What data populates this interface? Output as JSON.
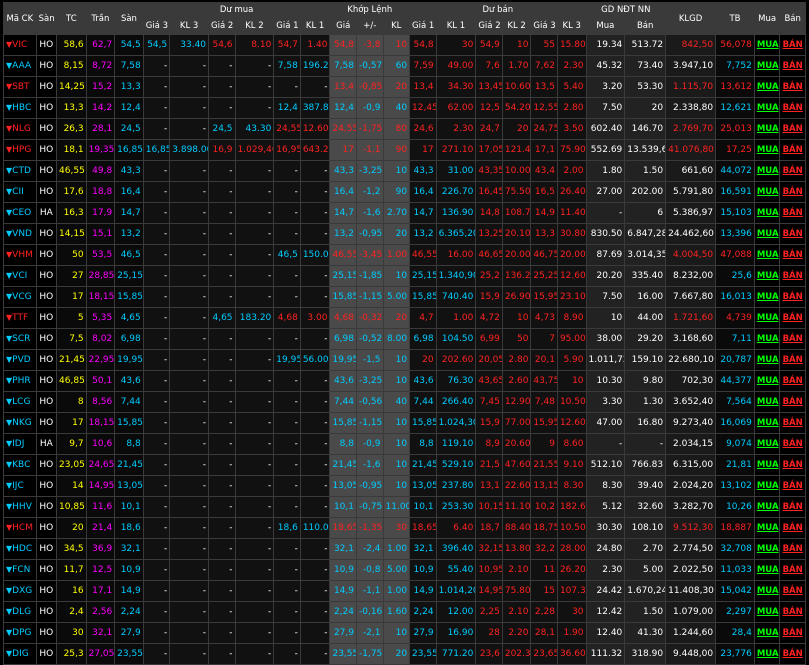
{
  "header": {
    "groups": {
      "symbol": "Mã CK",
      "exchange": "Sàn",
      "tc": "TC",
      "tran": "Trần",
      "san": "Sàn",
      "buy": "Dư mua",
      "match": "Khớp Lệnh",
      "sell": "Dư bán",
      "nn": "GD NĐT NN",
      "klgd": "KLGD",
      "tb": "TB",
      "mua": "Mua",
      "ban": "Bán"
    },
    "sub": {
      "buy": [
        "Giá 3",
        "KL 3",
        "Giá 2",
        "KL 2",
        "Giá 1",
        "KL 1"
      ],
      "match": [
        "Giá",
        "+/-",
        "KL"
      ],
      "sell": [
        "Giá 1",
        "KL 1",
        "Giá 2",
        "KL 2",
        "Giá 3",
        "KL 3"
      ],
      "nn": [
        "Mua",
        "Bán"
      ]
    }
  },
  "rows": [
    {
      "sym": "VIC",
      "dir": "dn",
      "ex": "HO",
      "tc": "58,6",
      "tran": "62,7",
      "san": "54,5",
      "b3p": "54,5",
      "b3k": "33.40",
      "b2p": "54,6",
      "b2k": "8.10",
      "b1p": "54,7",
      "b1k": "1.40",
      "mp": "54,8",
      "mc": "-3,8",
      "mk": "10",
      "s1p": "54,8",
      "s1k": "30",
      "s2p": "54,9",
      "s2k": "10",
      "s3p": "55",
      "s3k": "15.80",
      "nnb": "19.34",
      "nns": "513.72",
      "klgd": "842,50",
      "tb": "56,078"
    },
    {
      "sym": "AAA",
      "dir": "dn",
      "ex": "HO",
      "tc": "8,15",
      "tran": "8,72",
      "san": "7,58",
      "b3p": "-",
      "b3k": "-",
      "b2p": "-",
      "b2k": "-",
      "b1p": "7,58",
      "b1k": "196.20",
      "mp": "7,58",
      "mc": "-0,57",
      "mk": "60",
      "s1p": "7,59",
      "s1k": "49.00",
      "s2p": "7,6",
      "s2k": "1.70",
      "s3p": "7,62",
      "s3k": "2.30",
      "nnb": "45.32",
      "nns": "73.40",
      "klgd": "3.947,10",
      "tb": "7,752"
    },
    {
      "sym": "SBT",
      "dir": "dn",
      "ex": "HO",
      "tc": "14,25",
      "tran": "15,2",
      "san": "13,3",
      "b3p": "-",
      "b3k": "-",
      "b2p": "-",
      "b2k": "-",
      "b1p": "-",
      "b1k": "-",
      "mp": "13,4",
      "mc": "-0,85",
      "mk": "20",
      "s1p": "13,4",
      "s1k": "34.30",
      "s2p": "13,45",
      "s2k": "10.60",
      "s3p": "13,5",
      "s3k": "5.40",
      "nnb": "3.20",
      "nns": "53.30",
      "klgd": "1.115,70",
      "tb": "13,612"
    },
    {
      "sym": "HBC",
      "dir": "dn",
      "ex": "HO",
      "tc": "13,3",
      "tran": "14,2",
      "san": "12,4",
      "b3p": "-",
      "b3k": "-",
      "b2p": "-",
      "b2k": "-",
      "b1p": "12,4",
      "b1k": "387.80",
      "mp": "12,4",
      "mc": "-0,9",
      "mk": "40",
      "s1p": "12,45",
      "s1k": "62.00",
      "s2p": "12,5",
      "s2k": "54.20",
      "s3p": "12,55",
      "s3k": "2.80",
      "nnb": "7.50",
      "nns": "20",
      "klgd": "2.338,80",
      "tb": "12,621"
    },
    {
      "sym": "NLG",
      "dir": "dn",
      "ex": "HO",
      "tc": "26,3",
      "tran": "28,1",
      "san": "24,5",
      "b3p": "-",
      "b3k": "-",
      "b2p": "24,5",
      "b2k": "43.30",
      "b1p": "24,55",
      "b1k": "12.60",
      "mp": "24,55",
      "mc": "-1,75",
      "mk": "80",
      "s1p": "24,6",
      "s1k": "2.30",
      "s2p": "24,7",
      "s2k": "20",
      "s3p": "24,75",
      "s3k": "3.50",
      "nnb": "602.40",
      "nns": "146.70",
      "klgd": "2.769,70",
      "tb": "25,013"
    },
    {
      "sym": "HPG",
      "dir": "dn",
      "ex": "HO",
      "tc": "18,1",
      "tran": "19,35",
      "san": "16,85",
      "b3p": "16,85",
      "b3k": "3.898.00",
      "b2p": "16,9",
      "b2k": "1.029,40",
      "b1p": "16,95",
      "b1k": "643.20",
      "mp": "17",
      "mc": "-1,1",
      "mk": "90",
      "s1p": "17",
      "s1k": "271.10",
      "s2p": "17,05",
      "s2k": "121.40",
      "s3p": "17,1",
      "s3k": "75.90",
      "nnb": "552.69",
      "nns": "13.539,60",
      "klgd": "41.076,80",
      "tb": "17,25"
    },
    {
      "sym": "CTD",
      "dir": "dn",
      "ex": "HO",
      "tc": "46,55",
      "tran": "49,8",
      "san": "43,3",
      "b3p": "-",
      "b3k": "-",
      "b2p": "-",
      "b2k": "-",
      "b1p": "-",
      "b1k": "-",
      "mp": "43,3",
      "mc": "-3,25",
      "mk": "10",
      "s1p": "43,3",
      "s1k": "31.00",
      "s2p": "43,35",
      "s2k": "10.00",
      "s3p": "43,4",
      "s3k": "2.00",
      "nnb": "1.80",
      "nns": "1.50",
      "klgd": "661,60",
      "tb": "44,072"
    },
    {
      "sym": "CII",
      "dir": "dn",
      "ex": "HO",
      "tc": "17,6",
      "tran": "18,8",
      "san": "16,4",
      "b3p": "-",
      "b3k": "-",
      "b2p": "-",
      "b2k": "-",
      "b1p": "-",
      "b1k": "-",
      "mp": "16,4",
      "mc": "-1,2",
      "mk": "90",
      "s1p": "16,4",
      "s1k": "226.70",
      "s2p": "16,45",
      "s2k": "75.50",
      "s3p": "16,5",
      "s3k": "26.40",
      "nnb": "27.00",
      "nns": "202.00",
      "klgd": "5.791,80",
      "tb": "16,591"
    },
    {
      "sym": "CEO",
      "dir": "dn",
      "ex": "HA",
      "tc": "16,3",
      "tran": "17,9",
      "san": "14,7",
      "b3p": "-",
      "b3k": "-",
      "b2p": "-",
      "b2k": "-",
      "b1p": "-",
      "b1k": "-",
      "mp": "14,7",
      "mc": "-1,6",
      "mk": "2.70",
      "s1p": "14,7",
      "s1k": "136.90",
      "s2p": "14,8",
      "s2k": "108.70",
      "s3p": "14,9",
      "s3k": "11.40",
      "nnb": "-",
      "nns": "6",
      "klgd": "5.386,97",
      "tb": "15,103"
    },
    {
      "sym": "VND",
      "dir": "dn",
      "ex": "HO",
      "tc": "14,15",
      "tran": "15,1",
      "san": "13,2",
      "b3p": "-",
      "b3k": "-",
      "b2p": "-",
      "b2k": "-",
      "b1p": "-",
      "b1k": "-",
      "mp": "13,2",
      "mc": "-0,95",
      "mk": "20",
      "s1p": "13,2",
      "s1k": "6.365,20",
      "s2p": "13,25",
      "s2k": "20.10",
      "s3p": "13,3",
      "s3k": "30.80",
      "nnb": "830.50",
      "nns": "6.847,28",
      "klgd": "24.462,60",
      "tb": "13,396"
    },
    {
      "sym": "VHM",
      "dir": "dn",
      "ex": "HO",
      "tc": "50",
      "tran": "53,5",
      "san": "46,5",
      "b3p": "-",
      "b3k": "-",
      "b2p": "-",
      "b2k": "-",
      "b1p": "46,5",
      "b1k": "150.00",
      "mp": "46,55",
      "mc": "-3,45",
      "mk": "1.00",
      "s1p": "46,55",
      "s1k": "16.00",
      "s2p": "46,65",
      "s2k": "20.00",
      "s3p": "46,75",
      "s3k": "20.00",
      "nnb": "87.69",
      "nns": "3.014,35",
      "klgd": "4.004,50",
      "tb": "47,088"
    },
    {
      "sym": "VCI",
      "dir": "dn",
      "ex": "HO",
      "tc": "27",
      "tran": "28,85",
      "san": "25,15",
      "b3p": "-",
      "b3k": "-",
      "b2p": "-",
      "b2k": "-",
      "b1p": "-",
      "b1k": "-",
      "mp": "25,15",
      "mc": "-1,85",
      "mk": "10",
      "s1p": "25,15",
      "s1k": "1.340,90",
      "s2p": "25,2",
      "s2k": "136.20",
      "s3p": "25,25",
      "s3k": "12.60",
      "nnb": "20.20",
      "nns": "335.40",
      "klgd": "8.232,00",
      "tb": "25,6"
    },
    {
      "sym": "VCG",
      "dir": "dn",
      "ex": "HO",
      "tc": "17",
      "tran": "18,15",
      "san": "15,85",
      "b3p": "-",
      "b3k": "-",
      "b2p": "-",
      "b2k": "-",
      "b1p": "-",
      "b1k": "-",
      "mp": "15,85",
      "mc": "-1,15",
      "mk": "5.00",
      "s1p": "15,85",
      "s1k": "740.40",
      "s2p": "15,9",
      "s2k": "26.90",
      "s3p": "15,95",
      "s3k": "23.10",
      "nnb": "7.50",
      "nns": "16.00",
      "klgd": "7.667,80",
      "tb": "16,013"
    },
    {
      "sym": "TTF",
      "dir": "dn",
      "ex": "HO",
      "tc": "5",
      "tran": "5,35",
      "san": "4,65",
      "b3p": "-",
      "b3k": "-",
      "b2p": "4,65",
      "b2k": "183.20",
      "b1p": "4,68",
      "b1k": "3.00",
      "mp": "4,68",
      "mc": "-0,32",
      "mk": "20",
      "s1p": "4,7",
      "s1k": "1.00",
      "s2p": "4,72",
      "s2k": "10",
      "s3p": "4,73",
      "s3k": "8.90",
      "nnb": "10",
      "nns": "44.00",
      "klgd": "1.721,60",
      "tb": "4,739"
    },
    {
      "sym": "SCR",
      "dir": "dn",
      "ex": "HO",
      "tc": "7,5",
      "tran": "8,02",
      "san": "6,98",
      "b3p": "-",
      "b3k": "-",
      "b2p": "-",
      "b2k": "-",
      "b1p": "-",
      "b1k": "-",
      "mp": "6,98",
      "mc": "-0,52",
      "mk": "8.00",
      "s1p": "6,98",
      "s1k": "104.50",
      "s2p": "6,99",
      "s2k": "50",
      "s3p": "7",
      "s3k": "95.00",
      "nnb": "38.00",
      "nns": "29.20",
      "klgd": "3.168,60",
      "tb": "7,11"
    },
    {
      "sym": "PVD",
      "dir": "dn",
      "ex": "HO",
      "tc": "21,45",
      "tran": "22,95",
      "san": "19,95",
      "b3p": "-",
      "b3k": "-",
      "b2p": "-",
      "b2k": "-",
      "b1p": "19,95",
      "b1k": "56.00",
      "mp": "19,95",
      "mc": "-1,5",
      "mk": "10",
      "s1p": "20",
      "s1k": "202.60",
      "s2p": "20,05",
      "s2k": "2.80",
      "s3p": "20,1",
      "s3k": "5.90",
      "nnb": "1.011,72",
      "nns": "159.10",
      "klgd": "22.680,10",
      "tb": "20,787"
    },
    {
      "sym": "PHR",
      "dir": "dn",
      "ex": "HO",
      "tc": "46,85",
      "tran": "50,1",
      "san": "43,6",
      "b3p": "-",
      "b3k": "-",
      "b2p": "-",
      "b2k": "-",
      "b1p": "-",
      "b1k": "-",
      "mp": "43,6",
      "mc": "-3,25",
      "mk": "10",
      "s1p": "43,6",
      "s1k": "76.30",
      "s2p": "43,65",
      "s2k": "2.60",
      "s3p": "43,75",
      "s3k": "10",
      "nnb": "10.30",
      "nns": "9.80",
      "klgd": "702,30",
      "tb": "44,377"
    },
    {
      "sym": "LCG",
      "dir": "dn",
      "ex": "HO",
      "tc": "8",
      "tran": "8,56",
      "san": "7,44",
      "b3p": "-",
      "b3k": "-",
      "b2p": "-",
      "b2k": "-",
      "b1p": "-",
      "b1k": "-",
      "mp": "7,44",
      "mc": "-0,56",
      "mk": "40",
      "s1p": "7,44",
      "s1k": "266.40",
      "s2p": "7,45",
      "s2k": "12.90",
      "s3p": "7,48",
      "s3k": "10.50",
      "nnb": "3.30",
      "nns": "1.30",
      "klgd": "3.652,40",
      "tb": "7,564"
    },
    {
      "sym": "NKG",
      "dir": "dn",
      "ex": "HO",
      "tc": "17",
      "tran": "18,15",
      "san": "15,85",
      "b3p": "-",
      "b3k": "-",
      "b2p": "-",
      "b2k": "-",
      "b1p": "-",
      "b1k": "-",
      "mp": "15,85",
      "mc": "-1,15",
      "mk": "10",
      "s1p": "15,85",
      "s1k": "1.024,30",
      "s2p": "15,9",
      "s2k": "77.00",
      "s3p": "15,95",
      "s3k": "12.60",
      "nnb": "47.00",
      "nns": "16.80",
      "klgd": "9.273,40",
      "tb": "16,069"
    },
    {
      "sym": "IDJ",
      "dir": "dn",
      "ex": "HA",
      "tc": "9,7",
      "tran": "10,6",
      "san": "8,8",
      "b3p": "-",
      "b3k": "-",
      "b2p": "-",
      "b2k": "-",
      "b1p": "-",
      "b1k": "-",
      "mp": "8,8",
      "mc": "-0,9",
      "mk": "10",
      "s1p": "8,8",
      "s1k": "119.10",
      "s2p": "8,9",
      "s2k": "20.60",
      "s3p": "9",
      "s3k": "8.60",
      "nnb": "-",
      "nns": "-",
      "klgd": "2.034,15",
      "tb": "9,074"
    },
    {
      "sym": "KBC",
      "dir": "dn",
      "ex": "HO",
      "tc": "23,05",
      "tran": "24,65",
      "san": "21,45",
      "b3p": "-",
      "b3k": "-",
      "b2p": "-",
      "b2k": "-",
      "b1p": "-",
      "b1k": "-",
      "mp": "21,45",
      "mc": "-1,6",
      "mk": "10",
      "s1p": "21,45",
      "s1k": "529.10",
      "s2p": "21,5",
      "s2k": "47.60",
      "s3p": "21,55",
      "s3k": "9.10",
      "nnb": "512.10",
      "nns": "766.83",
      "klgd": "6.315,00",
      "tb": "21,81"
    },
    {
      "sym": "IJC",
      "dir": "dn",
      "ex": "HO",
      "tc": "14",
      "tran": "14,95",
      "san": "13,05",
      "b3p": "-",
      "b3k": "-",
      "b2p": "-",
      "b2k": "-",
      "b1p": "-",
      "b1k": "-",
      "mp": "13,05",
      "mc": "-0,95",
      "mk": "10",
      "s1p": "13,05",
      "s1k": "237.80",
      "s2p": "13,1",
      "s2k": "22.60",
      "s3p": "13,15",
      "s3k": "8.30",
      "nnb": "8.30",
      "nns": "39.40",
      "klgd": "2.024,20",
      "tb": "13,102"
    },
    {
      "sym": "HHV",
      "dir": "dn",
      "ex": "HO",
      "tc": "10,85",
      "tran": "11,6",
      "san": "10,1",
      "b3p": "-",
      "b3k": "-",
      "b2p": "-",
      "b2k": "-",
      "b1p": "-",
      "b1k": "-",
      "mp": "10,1",
      "mc": "-0,75",
      "mk": "11.00",
      "s1p": "10,1",
      "s1k": "253.30",
      "s2p": "10,15",
      "s2k": "11.10",
      "s3p": "10,2",
      "s3k": "182.60",
      "nnb": "5.12",
      "nns": "32.60",
      "klgd": "3.282,70",
      "tb": "10,26"
    },
    {
      "sym": "HCM",
      "dir": "dn",
      "ex": "HO",
      "tc": "20",
      "tran": "21,4",
      "san": "18,6",
      "b3p": "-",
      "b3k": "-",
      "b2p": "-",
      "b2k": "-",
      "b1p": "18,6",
      "b1k": "110.00",
      "mp": "18,65",
      "mc": "-1,35",
      "mk": "30",
      "s1p": "18,65",
      "s1k": "6.40",
      "s2p": "18,7",
      "s2k": "88.40",
      "s3p": "18,75",
      "s3k": "10.50",
      "nnb": "30.30",
      "nns": "108.10",
      "klgd": "9.512,30",
      "tb": "18,887"
    },
    {
      "sym": "HDC",
      "dir": "dn",
      "ex": "HO",
      "tc": "34,5",
      "tran": "36,9",
      "san": "32,1",
      "b3p": "-",
      "b3k": "-",
      "b2p": "-",
      "b2k": "-",
      "b1p": "-",
      "b1k": "-",
      "mp": "32,1",
      "mc": "-2,4",
      "mk": "1.00",
      "s1p": "32,1",
      "s1k": "396.40",
      "s2p": "32,15",
      "s2k": "13.80",
      "s3p": "32,2",
      "s3k": "28.00",
      "nnb": "24.80",
      "nns": "2.70",
      "klgd": "2.774,50",
      "tb": "32,708"
    },
    {
      "sym": "FCN",
      "dir": "dn",
      "ex": "HO",
      "tc": "11,7",
      "tran": "12,5",
      "san": "10,9",
      "b3p": "-",
      "b3k": "-",
      "b2p": "-",
      "b2k": "-",
      "b1p": "-",
      "b1k": "-",
      "mp": "10,9",
      "mc": "-0,8",
      "mk": "5.00",
      "s1p": "10,9",
      "s1k": "55.40",
      "s2p": "10,95",
      "s2k": "2.10",
      "s3p": "11",
      "s3k": "26.20",
      "nnb": "2.30",
      "nns": "5.00",
      "klgd": "2.022,50",
      "tb": "11,033"
    },
    {
      "sym": "DXG",
      "dir": "dn",
      "ex": "HO",
      "tc": "16",
      "tran": "17,1",
      "san": "14,9",
      "b3p": "-",
      "b3k": "-",
      "b2p": "-",
      "b2k": "-",
      "b1p": "-",
      "b1k": "-",
      "mp": "14,9",
      "mc": "-1,1",
      "mk": "1.00",
      "s1p": "14,9",
      "s1k": "1.014,20",
      "s2p": "14,95",
      "s2k": "75.80",
      "s3p": "15",
      "s3k": "107.30",
      "nnb": "24.42",
      "nns": "1.670,24",
      "klgd": "11.408,30",
      "tb": "15,042"
    },
    {
      "sym": "DLG",
      "dir": "dn",
      "ex": "HO",
      "tc": "2,4",
      "tran": "2,56",
      "san": "2,24",
      "b3p": "-",
      "b3k": "-",
      "b2p": "-",
      "b2k": "-",
      "b1p": "-",
      "b1k": "-",
      "mp": "2,24",
      "mc": "-0,16",
      "mk": "1.60",
      "s1p": "2,24",
      "s1k": "12.00",
      "s2p": "2,25",
      "s2k": "2.10",
      "s3p": "2,28",
      "s3k": "30",
      "nnb": "12.42",
      "nns": "1.50",
      "klgd": "1.079,00",
      "tb": "2,297"
    },
    {
      "sym": "DPG",
      "dir": "dn",
      "ex": "HO",
      "tc": "30",
      "tran": "32,1",
      "san": "27,9",
      "b3p": "-",
      "b3k": "-",
      "b2p": "-",
      "b2k": "-",
      "b1p": "-",
      "b1k": "-",
      "mp": "27,9",
      "mc": "-2,1",
      "mk": "10",
      "s1p": "27,9",
      "s1k": "16.90",
      "s2p": "28",
      "s2k": "2.20",
      "s3p": "28,1",
      "s3k": "1.90",
      "nnb": "12.40",
      "nns": "41.30",
      "klgd": "1.244,60",
      "tb": "28,4"
    },
    {
      "sym": "DIG",
      "dir": "dn",
      "ex": "HO",
      "tc": "25,3",
      "tran": "27,05",
      "san": "23,55",
      "b3p": "-",
      "b3k": "-",
      "b2p": "-",
      "b2k": "-",
      "b1p": "-",
      "b1k": "-",
      "mp": "23,55",
      "mc": "-1,75",
      "mk": "20",
      "s1p": "23,55",
      "s1k": "771.20",
      "s2p": "23,6",
      "s2k": "202.30",
      "s3p": "23,65",
      "s3k": "36.60",
      "nnb": "111.32",
      "nns": "318.90",
      "klgd": "9.448,00",
      "tb": "23,776"
    }
  ],
  "actions": {
    "buy_label": "MUA",
    "sell_label": "BÁN"
  },
  "colors": {
    "down": "#ff2222",
    "floor": "#00ccff",
    "ref": "#ffff00",
    "ceil": "#ff00ff",
    "up": "#00ff00"
  }
}
